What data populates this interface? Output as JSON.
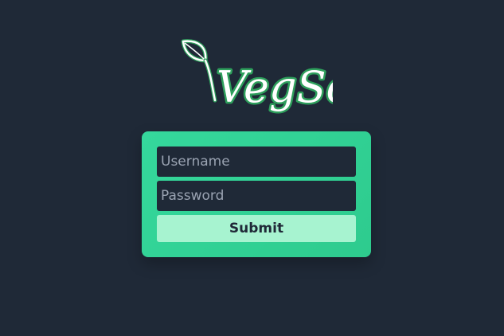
{
  "logo": {
    "text": "VegSoc",
    "leaf_icon": "leaf-icon",
    "text_color": "#ffffff",
    "outline_color": "#2e9f5c"
  },
  "login": {
    "username_placeholder": "Username",
    "password_placeholder": "Password",
    "submit_label": "Submit"
  },
  "colors": {
    "background": "#1f2937",
    "card": "#34d399",
    "submit_button": "#a7f3d0",
    "field_background": "#1f2937"
  }
}
